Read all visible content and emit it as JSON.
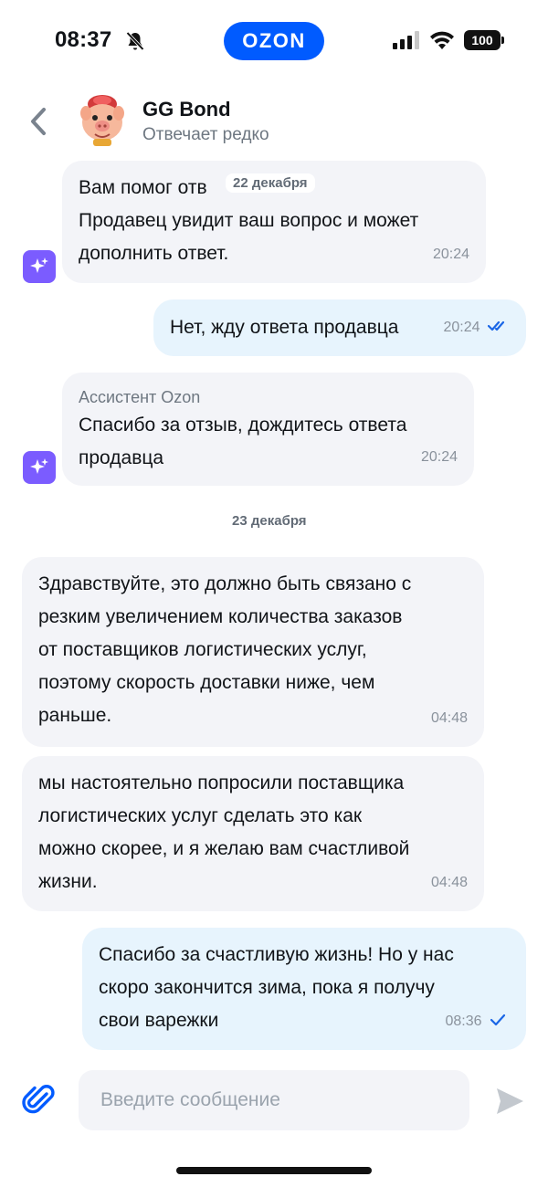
{
  "status_bar": {
    "time": "08:37",
    "battery": "100",
    "brand": "OZON"
  },
  "header": {
    "name": "GG Bond",
    "status": "Отвечает редко"
  },
  "messages": [
    {
      "text": "Вам помог отв\nПродавец увидит ваш вопрос и может\nдополнить ответ.",
      "time": "20:24"
    },
    {
      "text": "Нет, жду ответа продавца",
      "time": "20:24"
    },
    {
      "sender": "Ассистент Ozon",
      "text": "Спасибо за отзыв, дождитесь ответа\nпродавца",
      "time": "20:24"
    },
    {
      "text": "Здравствуйте, это должно быть связано с\nрезким увеличением количества заказов\nот поставщиков логистических услуг,\nпоэтому скорость доставки ниже, чем\nраньше.",
      "time": "04:48"
    },
    {
      "text": "мы настоятельно попросили поставщика\nлогистических услуг сделать это как\nможно скорее, и я желаю вам счастливой\nжизни.",
      "time": "04:48"
    },
    {
      "text": "Спасибо за счастливую жизнь! Но у нас\nскоро закончится зима, пока я получу\nсвои варежки",
      "time": "08:36"
    }
  ],
  "dates": {
    "sticky": "22 декабря",
    "separator": "23 декабря"
  },
  "composer": {
    "placeholder": "Введите сообщение"
  },
  "colors": {
    "brand": "#005bff",
    "incoming_bubble": "#f3f4f8",
    "outgoing_bubble": "#e7f4fd",
    "assistant": "#7b5cff",
    "read_check": "#1a66e6"
  },
  "icons": [
    "muted-bell-icon",
    "cellular-signal-icon",
    "wifi-icon",
    "battery-icon",
    "chevron-left-icon",
    "sparkle-icon",
    "double-check-icon",
    "single-check-icon",
    "paperclip-icon",
    "send-icon"
  ]
}
